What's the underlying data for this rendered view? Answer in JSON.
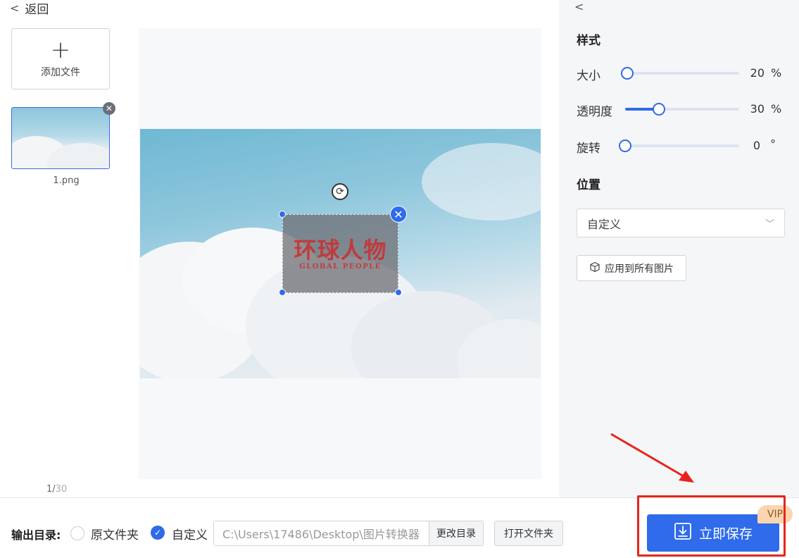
{
  "header": {
    "back_label": "返回"
  },
  "left": {
    "add_file_label": "添加文件",
    "files": [
      {
        "name": "1.png"
      }
    ],
    "page": {
      "current": "1/",
      "total": "30"
    }
  },
  "watermark": {
    "title": "环球人物",
    "subtitle": "GLOBAL PEOPLE"
  },
  "panel": {
    "style_title": "样式",
    "size": {
      "label": "大小",
      "value": "20",
      "unit": "%",
      "level": 0.0
    },
    "opacity": {
      "label": "透明度",
      "value": "30",
      "unit": "%",
      "level": 0.3
    },
    "rotation": {
      "label": "旋转",
      "value": "0",
      "unit": "°",
      "level": 0.0
    },
    "position_title": "位置",
    "position_value": "自定义",
    "apply_all_label": "应用到所有图片"
  },
  "bottom": {
    "output_label": "输出目录:",
    "option_original": "原文件夹",
    "option_custom": "自定义",
    "selected": "custom",
    "path": "C:\\Users\\17486\\Desktop\\图片转换器",
    "change_dir_label": "更改目录",
    "open_folder_label": "打开文件夹",
    "save_label": "立即保存",
    "vip_label": "VIP"
  },
  "colors": {
    "accent": "#2f6bea",
    "highlight": "#e8241a",
    "vip_bg": "#fbd5b0"
  }
}
